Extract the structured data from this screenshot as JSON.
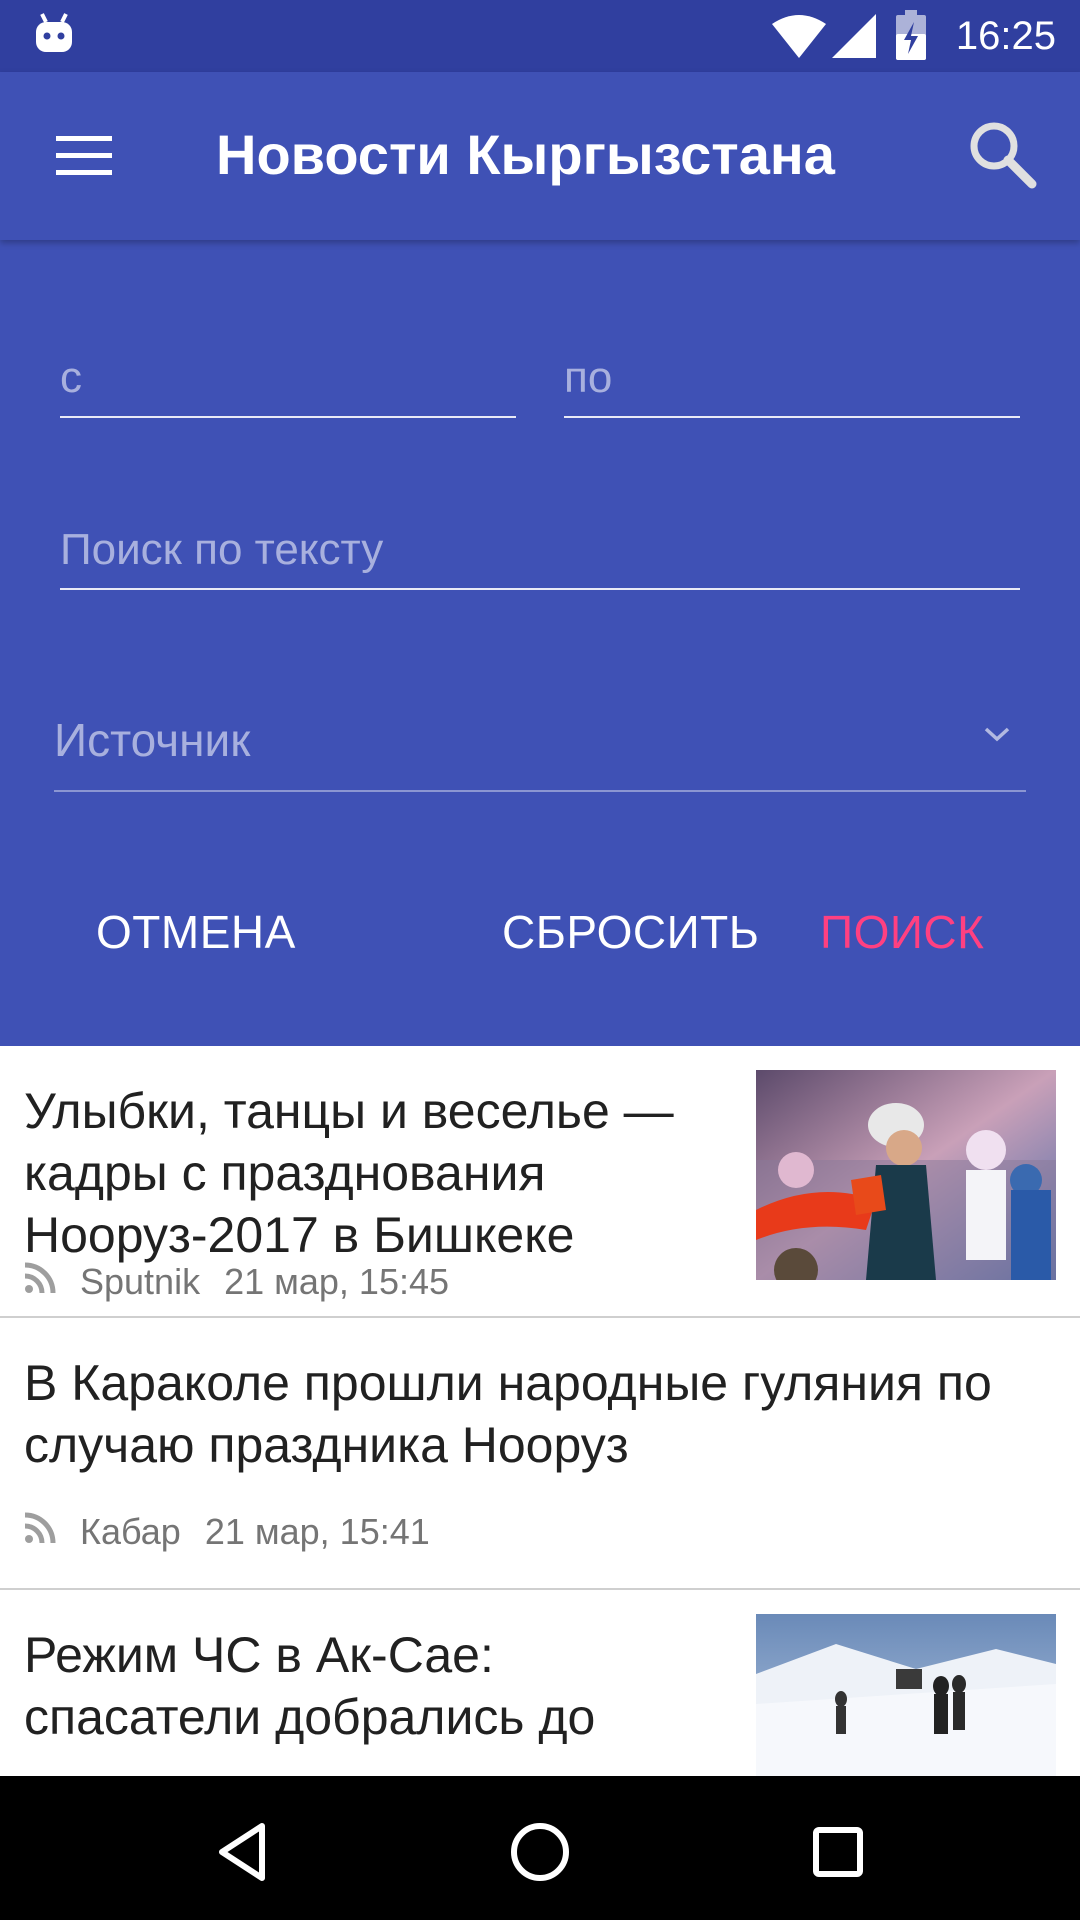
{
  "status_bar": {
    "time": "16:25",
    "icons": [
      "android-debug-icon",
      "wifi-icon",
      "cellular-signal-icon",
      "battery-charging-icon"
    ]
  },
  "toolbar": {
    "title": "Новости Кыргызстана",
    "menu_icon": "hamburger-menu-icon",
    "search_icon": "search-icon"
  },
  "filter": {
    "date_from_placeholder": "с",
    "date_to_placeholder": "по",
    "text_search_placeholder": "Поиск по тексту",
    "source_select_value": "Источник",
    "cancel_label": "ОТМЕНА",
    "reset_label": "СБРОСИТЬ",
    "search_label": "ПОИСК"
  },
  "news": [
    {
      "headline": "Улыбки, танцы и веселье — кадры с празднования Нооруз-2017 в Бишкеке",
      "source": "Sputnik",
      "time": "21 мар, 15:45",
      "has_thumbnail": true
    },
    {
      "headline": "В Караколе прошли народные гуляния по случаю праздника Нооруз",
      "source": "Кабар",
      "time": "21 мар, 15:41",
      "has_thumbnail": false
    },
    {
      "headline": "Режим ЧС в Ак-Сае: спасатели добрались до",
      "has_thumbnail": true
    }
  ],
  "colors": {
    "status_bar": "#303f9f",
    "primary": "#3f51b5",
    "accent": "#ff4081",
    "nav_bar": "#000000"
  }
}
